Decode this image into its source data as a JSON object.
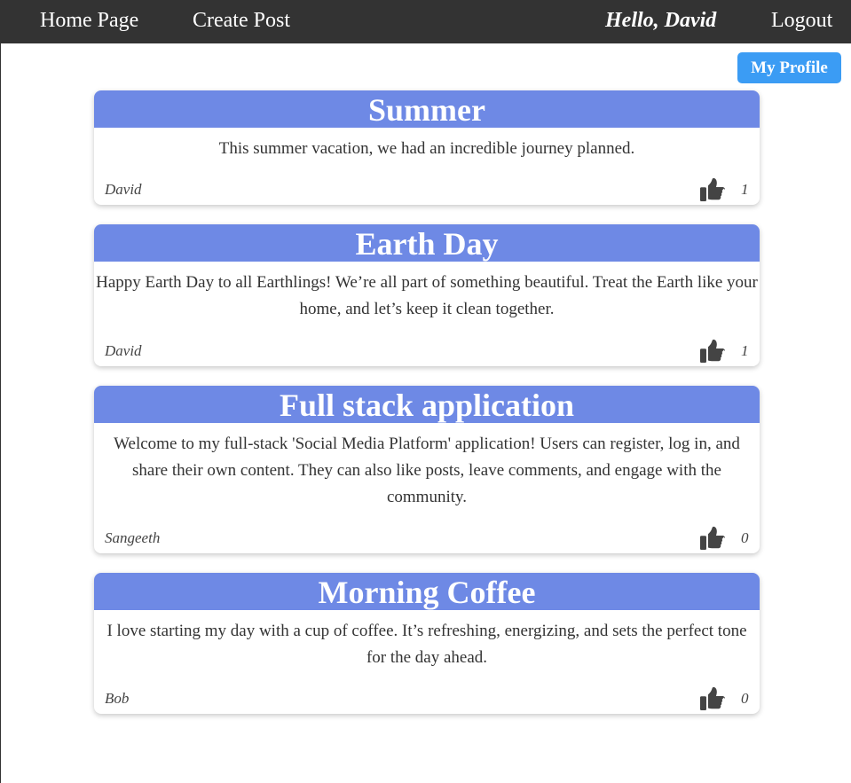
{
  "nav": {
    "home": "Home Page",
    "create_post": "Create Post",
    "greeting": "Hello, David",
    "logout": "Logout"
  },
  "profile_button": "My Profile",
  "posts": [
    {
      "title": "Summer",
      "body": "This summer vacation, we had an incredible journey planned.",
      "author": "David",
      "likes": "1"
    },
    {
      "title": "Earth Day",
      "body": "Happy Earth Day to all Earthlings! We’re all part of something beautiful. Treat the Earth like your home, and let’s keep it clean together.",
      "author": "David",
      "likes": "1"
    },
    {
      "title": "Full stack application",
      "body": "Welcome to my full-stack 'Social Media Platform' application! Users can register, log in, and share their own content. They can also like posts, leave comments, and engage with the community.",
      "author": "Sangeeth",
      "likes": "0"
    },
    {
      "title": "Morning Coffee",
      "body": "I love starting my day with a cup of coffee. It’s refreshing, energizing, and sets the perfect tone for the day ahead.",
      "author": "Bob",
      "likes": "0"
    }
  ],
  "colors": {
    "navbar": "#333333",
    "post_header": "#6e89e5",
    "profile_button": "#3b9cf4",
    "like_icon": "#444444"
  },
  "icons": {
    "like": "thumbs-up-icon"
  }
}
